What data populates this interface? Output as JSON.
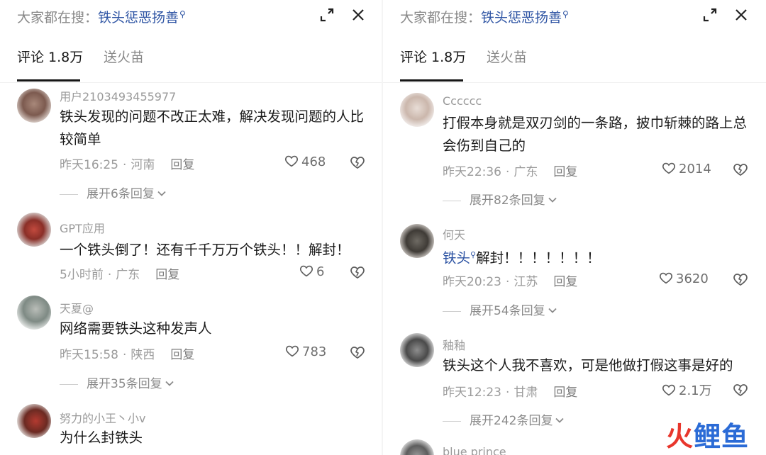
{
  "colors": {
    "accent_link": "#2f55a4",
    "meta_gray": "#9b9b9b",
    "watermark_red": "#e8362c",
    "watermark_blue": "#2b6bd6"
  },
  "left": {
    "search": {
      "prefix": "大家都在搜：",
      "term": "铁头惩恶扬善"
    },
    "tabs": {
      "comments": "评论 1.8万",
      "gift": "送火苗"
    },
    "comments": [
      {
        "user": "用户2103493455977",
        "text": "铁头发现的问题不改正太难，解决发现问题的人比较简单",
        "time": "昨天16:25",
        "region": "河南",
        "reply": "回复",
        "likes": "468",
        "expand": "展开6条回复"
      },
      {
        "user": "GPT应用",
        "text": "一个铁头倒了！还有千千万万个铁头！！解封！",
        "time": "5小时前",
        "region": "广东",
        "reply": "回复",
        "likes": "6"
      },
      {
        "user": "天夏@",
        "text": "网络需要铁头这种发声人",
        "time": "昨天15:58",
        "region": "陕西",
        "reply": "回复",
        "likes": "783",
        "expand": "展开35条回复"
      },
      {
        "user": "努力的小王丶小v",
        "text": "为什么封铁头"
      }
    ]
  },
  "right": {
    "search": {
      "prefix": "大家都在搜：",
      "term": "铁头惩恶扬善"
    },
    "tabs": {
      "comments": "评论 1.8万",
      "gift": "送火苗"
    },
    "comments": [
      {
        "user": "Cccccc",
        "text": "打假本身就是双刃剑的一条路，披巾斩棘的路上总会伤到自己的",
        "time": "昨天22:36",
        "region": "广东",
        "reply": "回复",
        "likes": "2014",
        "expand": "展开82条回复"
      },
      {
        "user": "何天",
        "mention": "铁头",
        "text_rest": "解封！！！！！！！",
        "time": "昨天20:23",
        "region": "江苏",
        "reply": "回复",
        "likes": "3620",
        "expand": "展开54条回复"
      },
      {
        "user": "釉釉",
        "text": "铁头这个人我不喜欢，可是他做打假这事是好的",
        "time": "昨天12:23",
        "region": "甘肃",
        "reply": "回复",
        "likes": "2.1万",
        "expand": "展开242条回复"
      },
      {
        "user": "blue prince"
      }
    ]
  },
  "watermark": {
    "part1": "火",
    "part2": "鲤鱼"
  }
}
